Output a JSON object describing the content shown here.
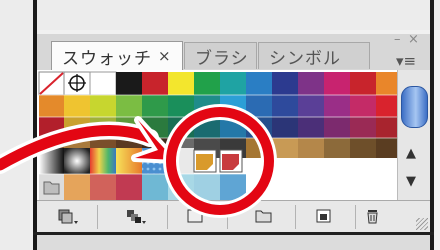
{
  "panel": {
    "tabs": [
      {
        "label": "スウォッチ",
        "close": "×"
      },
      {
        "label": "ブラシ"
      },
      {
        "label": "シンボル"
      }
    ],
    "window_minimize": "–",
    "window_close": "×",
    "panel_menu": "▾≡"
  },
  "swatches": {
    "colors": {
      "white": "#ffffff",
      "black": "#1a1a1a",
      "reds": [
        "#c8242c",
        "#d9232d",
        "#b21f2b"
      ],
      "highlighted": [
        "#d99a2b",
        "#c83b3e"
      ]
    }
  },
  "scrollbar": {
    "up": "▲",
    "down": "▼"
  },
  "toolbar": {
    "icons": [
      "swatch-libraries-menu-icon",
      "show-swatch-kinds-icon",
      "swatch-options-icon",
      "new-color-group-icon",
      "new-swatch-icon",
      "delete-swatch-icon"
    ]
  },
  "annotation": {
    "circle_color": "#e30613",
    "arrow_color": "#e30613",
    "outline_color": "#ffffff"
  }
}
